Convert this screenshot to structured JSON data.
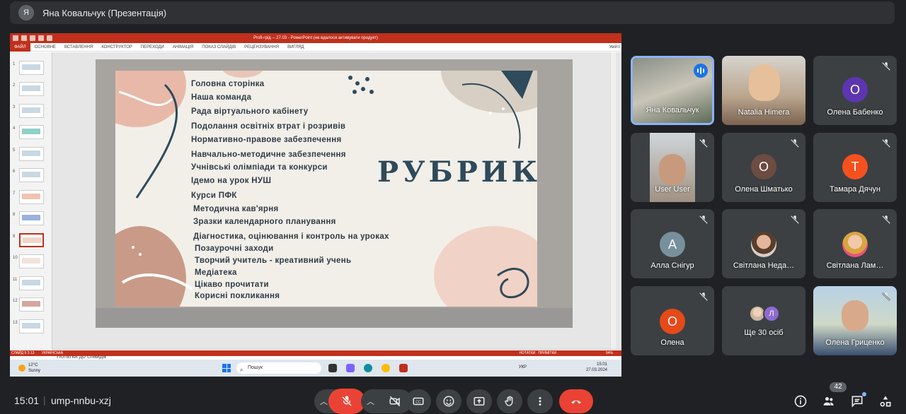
{
  "presenter": {
    "initial": "Я",
    "label": "Яна Ковальчук (Презентація)"
  },
  "ppt": {
    "title": "Profi-грід -- 27.03 - PowerPoint (не вдалося активувати продукт)",
    "tabs": [
      "ФАЙЛ",
      "ОСНОВНЕ",
      "ВСТАВЛЕННЯ",
      "КОНСТРУКТОР",
      "ПЕРЕХОДИ",
      "АНІМАЦІЯ",
      "ПОКАЗ СЛАЙДІВ",
      "РЕЦЕНЗУВАННЯ",
      "ВИГЛЯД"
    ],
    "user_label": "Увійті",
    "thumb_numbers": [
      "1",
      "2",
      "3",
      "4",
      "5",
      "6",
      "7",
      "8",
      "9",
      "10",
      "11",
      "12",
      "13"
    ],
    "notes_placeholder": "Нотатки до слайда",
    "status_left": "СЛАЙД 9 З 13",
    "status_lang": "УКРАЇНСЬКА",
    "status_notes": "НОТАТКИ",
    "status_comments": "ПРИМІТКИ",
    "zoom": "94%"
  },
  "slide": {
    "title": "РУБРИКИ",
    "items": [
      "Головна сторінка",
      "Наша команда",
      "Рада віртуального кабінету",
      "Подолання освітніх втрат і розривів",
      "Нормативно-правове забезпечення",
      "Навчально-методичне забезпечення",
      "Учнівські олімпіади та конкурси",
      "Ідемо на урок НУШ",
      "Курси ПФК",
      "Методична кав'ярня",
      "Зразки календарного планування",
      "Діагностика, оцінювання і контроль на уроках",
      "Позаурочні заходи",
      "Творчий учитель - креативний учень",
      "Медіатека",
      "Цікаво прочитати",
      "Корисні покликання"
    ]
  },
  "taskbar": {
    "weather_temp": "12°C",
    "weather_desc": "Sunny",
    "search_placeholder": "Пошук",
    "lang": "УКР",
    "time": "15:01",
    "date": "27.03.2024"
  },
  "participants": [
    {
      "name": "Яна Ковальчук",
      "type": "video",
      "speaking": true
    },
    {
      "name": "Natalia Himera",
      "type": "video"
    },
    {
      "name": "Олена Бабенко",
      "initial": "О",
      "color": "#5e35b1",
      "muted": true
    },
    {
      "name": "User User",
      "type": "video",
      "muted": true
    },
    {
      "name": "Олена Шматько",
      "initial": "О",
      "color": "#6d4c41",
      "muted": true
    },
    {
      "name": "Тамара Дячун",
      "initial": "Т",
      "color": "#f4511e",
      "muted": true
    },
    {
      "name": "Алла Снігур",
      "initial": "А",
      "color": "#78909c",
      "muted": true
    },
    {
      "name": "Світлана Неда…",
      "type": "photo",
      "muted": true
    },
    {
      "name": "Світлана Лам…",
      "type": "photo",
      "muted": true
    },
    {
      "name": "Олена",
      "initial": "О",
      "color": "#e64a19",
      "muted": true
    },
    {
      "name": "Ще 30 осіб",
      "type": "more",
      "initial": "Л"
    },
    {
      "name": "Олена Гриценко",
      "type": "video",
      "muted": true
    }
  ],
  "meeting": {
    "time": "15:01",
    "separator": "|",
    "code": "ump-nnbu-xzj",
    "people_count": "42"
  },
  "colors": {
    "end_call": "#ea4335",
    "mic_off": "#ea4335",
    "accent": "#8ab4f8"
  }
}
